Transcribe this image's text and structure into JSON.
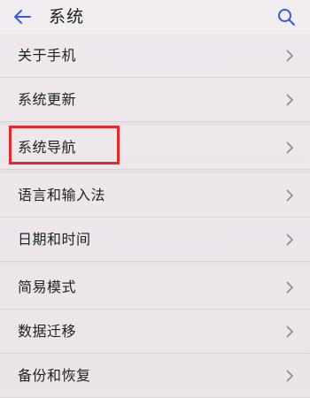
{
  "header": {
    "title": "系统"
  },
  "list": {
    "items": [
      {
        "label": "关于手机"
      },
      {
        "label": "系统更新"
      },
      {
        "label": "系统导航"
      },
      {
        "label": "语言和输入法"
      },
      {
        "label": "日期和时间"
      },
      {
        "label": "简易模式"
      },
      {
        "label": "数据迁移"
      },
      {
        "label": "备份和恢复"
      }
    ]
  },
  "colors": {
    "accent": "#3b5bd6",
    "highlight_box": "#e8272b",
    "background": "#ece6eb"
  },
  "icons": {
    "back": "back-arrow-icon",
    "search": "search-icon",
    "chevron": "chevron-right-icon"
  }
}
